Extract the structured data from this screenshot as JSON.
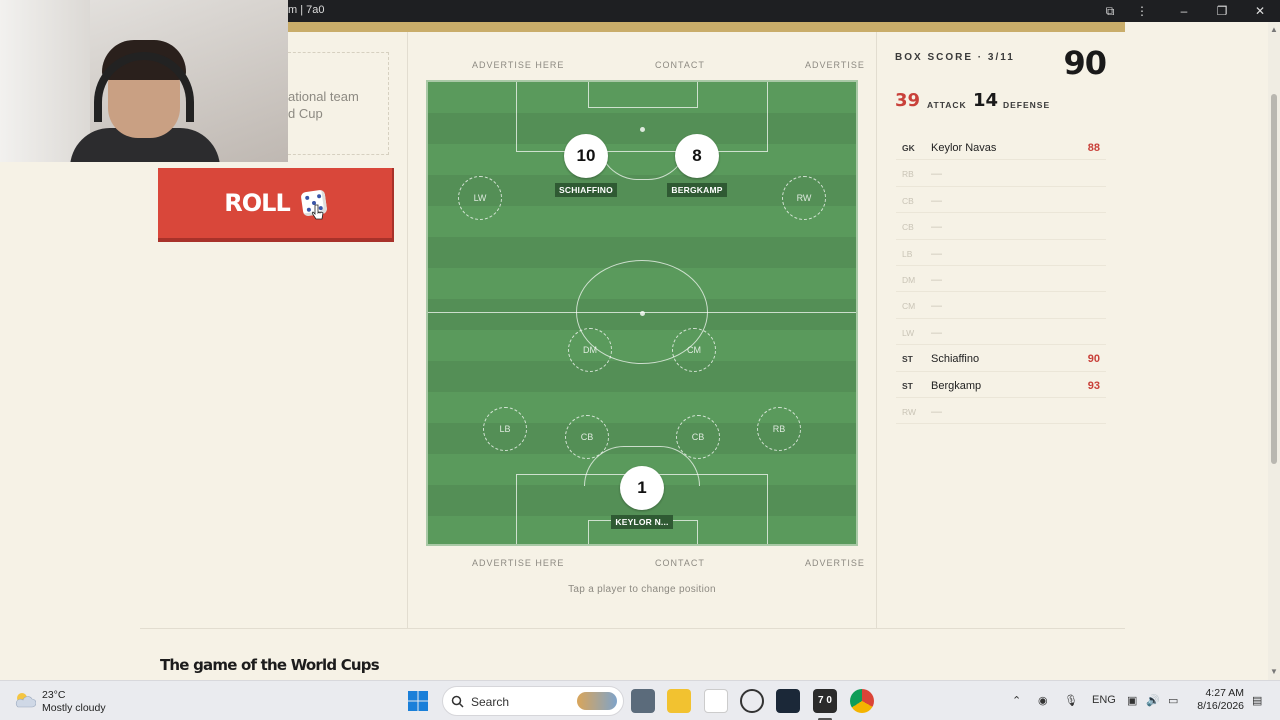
{
  "window": {
    "title": "m | 7a0"
  },
  "promo": {
    "line1": "ational team",
    "line2": "d Cup"
  },
  "roll_button": {
    "label": "ROLL"
  },
  "ads_top": {
    "left": "ADVERTISE HERE",
    "center": "CONTACT",
    "right": "ADVERTISE"
  },
  "ads_bottom": {
    "left": "ADVERTISE HERE",
    "center": "CONTACT",
    "right": "ADVERTISE"
  },
  "hint": "Tap a player to change position",
  "footer_title": "The game of the World Cups",
  "pitch": {
    "empty_slots": {
      "lw": "LW",
      "rw": "RW",
      "dm": "DM",
      "cm": "CM",
      "lb": "LB",
      "cb1": "CB",
      "cb2": "CB",
      "rb": "RB"
    },
    "players": [
      {
        "number": "10",
        "name": "SCHIAFFINO"
      },
      {
        "number": "8",
        "name": "BERGKAMP"
      },
      {
        "number": "1",
        "name": "KEYLOR N..."
      }
    ]
  },
  "box_score": {
    "title": "BOX SCORE · 3/11",
    "total": "90",
    "attack_value": "39",
    "attack_label": "ATTACK",
    "defense_value": "14",
    "defense_label": "DEFENSE",
    "rows": [
      {
        "pos": "GK",
        "name": "Keylor Navas",
        "rating": "88"
      },
      {
        "pos": "RB",
        "name": "—",
        "rating": ""
      },
      {
        "pos": "CB",
        "name": "—",
        "rating": ""
      },
      {
        "pos": "CB",
        "name": "—",
        "rating": ""
      },
      {
        "pos": "LB",
        "name": "—",
        "rating": ""
      },
      {
        "pos": "DM",
        "name": "—",
        "rating": ""
      },
      {
        "pos": "CM",
        "name": "—",
        "rating": ""
      },
      {
        "pos": "LW",
        "name": "—",
        "rating": ""
      },
      {
        "pos": "ST",
        "name": "Schiaffino",
        "rating": "90"
      },
      {
        "pos": "ST",
        "name": "Bergkamp",
        "rating": "93"
      },
      {
        "pos": "RW",
        "name": "—",
        "rating": ""
      }
    ]
  },
  "taskbar": {
    "weather_temp": "23°C",
    "weather_desc": "Mostly cloudy",
    "search_label": "Search",
    "active_app": "7 0",
    "lang": "ENG",
    "time": "4:27 AM",
    "date": "8/16/2026"
  },
  "colors": {
    "accent": "#d9473a",
    "pitch": "#5a9a5c",
    "rating": "#c9413a",
    "gold": "#c9ad6a"
  },
  "icons": [
    "dice-icon",
    "cursor-icon",
    "cloud-icon",
    "windows-icon",
    "search-icon",
    "chevron-up-icon",
    "mic-icon",
    "speaker-icon",
    "wifi-icon",
    "battery-icon"
  ]
}
